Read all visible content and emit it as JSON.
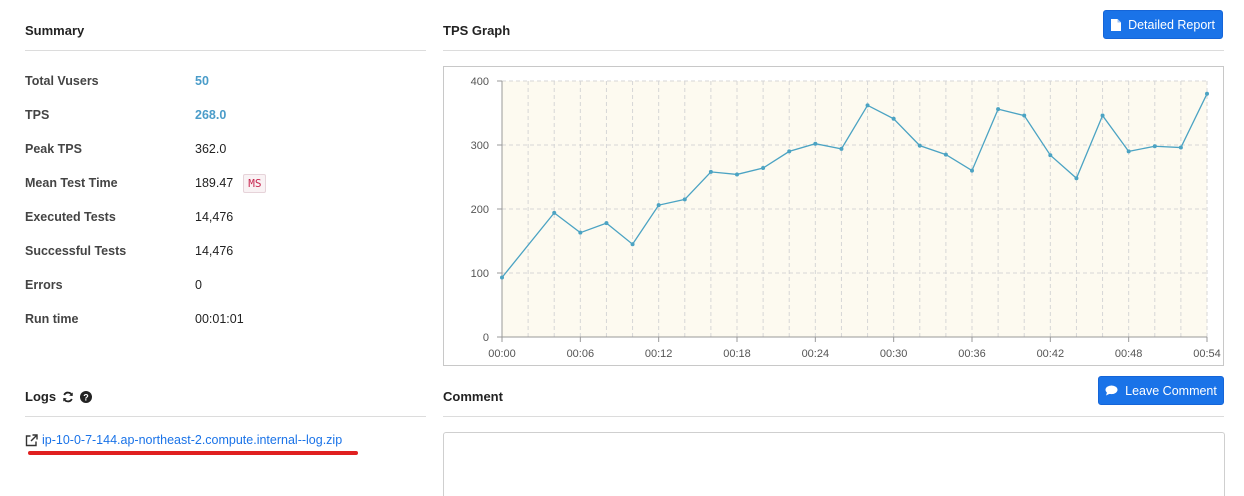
{
  "summary": {
    "title": "Summary",
    "rows": [
      {
        "label": "Total Vusers",
        "value": "50"
      },
      {
        "label": "TPS",
        "value": "268.0"
      },
      {
        "label": "Peak TPS",
        "value": "362.0"
      },
      {
        "label": "Mean Test Time",
        "value": "189.47",
        "unit": "MS"
      },
      {
        "label": "Executed Tests",
        "value": "14,476"
      },
      {
        "label": "Successful Tests",
        "value": "14,476"
      },
      {
        "label": "Errors",
        "value": "0"
      },
      {
        "label": "Run time",
        "value": "00:01:01"
      }
    ]
  },
  "graph": {
    "title": "TPS Graph",
    "detailed_report_label": "Detailed Report"
  },
  "chart_data": {
    "type": "line",
    "title": "",
    "xlabel": "",
    "ylabel": "",
    "ylim": [
      0,
      400
    ],
    "yticks": [
      0,
      100,
      200,
      300,
      400
    ],
    "xtick_labels": [
      "00:00",
      "00:06",
      "00:12",
      "00:18",
      "00:24",
      "00:30",
      "00:36",
      "00:42",
      "00:48",
      "00:54"
    ],
    "xlim_seconds": [
      0,
      54
    ],
    "grid": true,
    "line_color": "#4ba3c3",
    "background_color": "#fdfaf0",
    "series": [
      {
        "x": [
          "00:00",
          "00:04",
          "00:06",
          "00:08",
          "00:10",
          "00:12",
          "00:14",
          "00:16",
          "00:18",
          "00:20",
          "00:22",
          "00:24",
          "00:26",
          "00:28",
          "00:30",
          "00:32",
          "00:34",
          "00:36",
          "00:38",
          "00:40",
          "00:42",
          "00:44",
          "00:46",
          "00:48",
          "00:50",
          "00:52",
          "00:54"
        ],
        "values": [
          93,
          194,
          163,
          178,
          145,
          206,
          215,
          258,
          254,
          264,
          290,
          302,
          294,
          362,
          341,
          299,
          285,
          260,
          356,
          346,
          284,
          248,
          346,
          290,
          298,
          296,
          380
        ]
      }
    ]
  },
  "logs": {
    "title": "Logs",
    "file_name": "ip-10-0-7-144.ap-northeast-2.compute.internal--log.zip"
  },
  "comment": {
    "title": "Comment",
    "leave_comment_label": "Leave Comment"
  },
  "colors": {
    "accent": "#1a73e8",
    "highlight_value": "#4a9cc9",
    "annotation_red": "#e02020"
  }
}
